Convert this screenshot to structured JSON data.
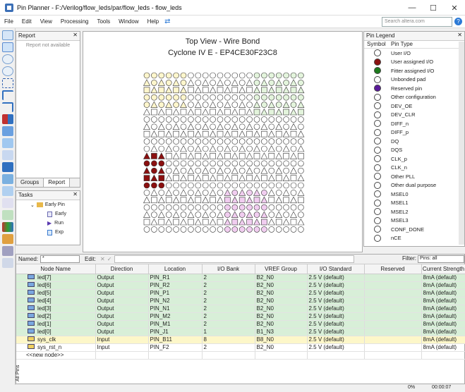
{
  "window": {
    "title": "Pin Planner - F:/Verilog/flow_leds/par/flow_leds - flow_leds",
    "controls": [
      "—",
      "☐",
      "✕"
    ]
  },
  "menu": {
    "items": [
      "File",
      "Edit",
      "View",
      "Processing",
      "Tools",
      "Window",
      "Help"
    ],
    "search_placeholder": "Search altera.com"
  },
  "report": {
    "title": "Report",
    "message": "Report not available",
    "tabs": [
      "Groups",
      "Report"
    ]
  },
  "tasks": {
    "title": "Tasks",
    "items": [
      {
        "label": "Early Pin",
        "level": 0
      },
      {
        "label": "Early",
        "level": 1
      },
      {
        "label": "Run",
        "level": 1
      },
      {
        "label": "Exp",
        "level": 1
      }
    ]
  },
  "package_view": {
    "title": "Top View - Wire Bond",
    "subtitle": "Cyclone IV E - EP4CE30F23C8"
  },
  "legend": {
    "title": "Pin Legend",
    "col_symbol": "Symbol",
    "col_type": "Pin Type",
    "rows": [
      {
        "label": "User I/O",
        "color": "#ffffff"
      },
      {
        "label": "User assigned I/O",
        "color": "#8b1010"
      },
      {
        "label": "Fitter assigned I/O",
        "color": "#1d7a1d"
      },
      {
        "label": "Unbonded pad",
        "color": "#ffffff"
      },
      {
        "label": "Reserved pin",
        "color": "#5a1a9a"
      },
      {
        "label": "Other configuration",
        "color": "#ffffff"
      },
      {
        "label": "DEV_OE",
        "color": "#ffffff"
      },
      {
        "label": "DEV_CLR",
        "color": "#ffffff"
      },
      {
        "label": "DIFF_n",
        "color": "#ffffff"
      },
      {
        "label": "DIFF_p",
        "color": "#ffffff"
      },
      {
        "label": "DQ",
        "color": "#ffffff"
      },
      {
        "label": "DQS",
        "color": "#ffffff"
      },
      {
        "label": "CLK_p",
        "color": "#ffffff"
      },
      {
        "label": "CLK_n",
        "color": "#ffffff"
      },
      {
        "label": "Other PLL",
        "color": "#ffffff"
      },
      {
        "label": "Other dual purpose",
        "color": "#ffffff"
      },
      {
        "label": "MSEL0",
        "color": "#ffffff"
      },
      {
        "label": "MSEL1",
        "color": "#ffffff"
      },
      {
        "label": "MSEL2",
        "color": "#ffffff"
      },
      {
        "label": "MSEL3",
        "color": "#ffffff"
      },
      {
        "label": "CONF_DONE",
        "color": "#ffffff"
      },
      {
        "label": "nCE",
        "color": "#ffffff"
      }
    ]
  },
  "filter": {
    "named_label": "Named:",
    "named_value": "*",
    "edit_label": "Edit:",
    "filter_label": "Filter:",
    "filter_value": "Pins: all"
  },
  "table": {
    "columns": [
      "Node Name",
      "Direction",
      "Location",
      "I/O Bank",
      "VREF Group",
      "I/O Standard",
      "Reserved",
      "Current Strength"
    ],
    "rows": [
      {
        "name": "led[7]",
        "dir": "Output",
        "loc": "PIN_R1",
        "bank": "2",
        "vref": "B2_N0",
        "std": "2.5 V (default)",
        "res": "",
        "cur": "8mA (default)",
        "style": "g"
      },
      {
        "name": "led[6]",
        "dir": "Output",
        "loc": "PIN_R2",
        "bank": "2",
        "vref": "B2_N0",
        "std": "2.5 V (default)",
        "res": "",
        "cur": "8mA (default)",
        "style": "g"
      },
      {
        "name": "led[5]",
        "dir": "Output",
        "loc": "PIN_P1",
        "bank": "2",
        "vref": "B2_N0",
        "std": "2.5 V (default)",
        "res": "",
        "cur": "8mA (default)",
        "style": "g"
      },
      {
        "name": "led[4]",
        "dir": "Output",
        "loc": "PIN_N2",
        "bank": "2",
        "vref": "B2_N0",
        "std": "2.5 V (default)",
        "res": "",
        "cur": "8mA (default)",
        "style": "g"
      },
      {
        "name": "led[3]",
        "dir": "Output",
        "loc": "PIN_N1",
        "bank": "2",
        "vref": "B2_N0",
        "std": "2.5 V (default)",
        "res": "",
        "cur": "8mA (default)",
        "style": "g"
      },
      {
        "name": "led[2]",
        "dir": "Output",
        "loc": "PIN_M2",
        "bank": "2",
        "vref": "B2_N0",
        "std": "2.5 V (default)",
        "res": "",
        "cur": "8mA (default)",
        "style": "g"
      },
      {
        "name": "led[1]",
        "dir": "Output",
        "loc": "PIN_M1",
        "bank": "2",
        "vref": "B2_N0",
        "std": "2.5 V (default)",
        "res": "",
        "cur": "8mA (default)",
        "style": "g"
      },
      {
        "name": "led[0]",
        "dir": "Output",
        "loc": "PIN_J1",
        "bank": "1",
        "vref": "B1_N3",
        "std": "2.5 V (default)",
        "res": "",
        "cur": "8mA (default)",
        "style": "g"
      },
      {
        "name": "sys_clk",
        "dir": "Input",
        "loc": "PIN_B11",
        "bank": "8",
        "vref": "B8_N0",
        "std": "2.5 V (default)",
        "res": "",
        "cur": "8mA (default)",
        "style": "y"
      },
      {
        "name": "sys_rst_n",
        "dir": "Input",
        "loc": "PIN_F2",
        "bank": "2",
        "vref": "B2_N0",
        "std": "2.5 V (default)",
        "res": "",
        "cur": "8mA (default)",
        "style": "w"
      }
    ],
    "new_node": "<<new node>>"
  },
  "side_tab": "All Pins",
  "status": {
    "progress": "0%",
    "time": "00:00:07"
  }
}
